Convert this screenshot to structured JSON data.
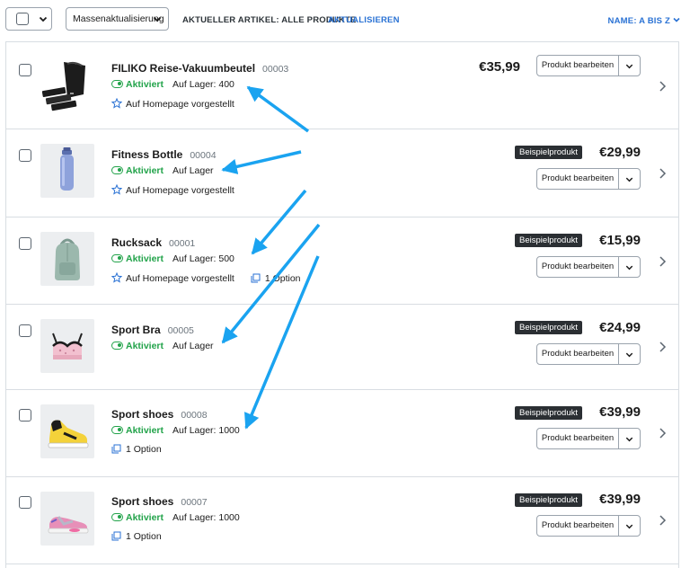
{
  "toolbar": {
    "bulk_label": "Massenaktualisierung",
    "current_article": "AKTUELLER ARTIKEL: ALLE PRODUKTE",
    "refresh_label": "AKTUALISIEREN",
    "sort_label": "NAME: A BIS Z"
  },
  "colors": {
    "accent": "#2a72d4",
    "active": "#22a34a",
    "badge": "#2b2f33",
    "annotation_arrow": "#1aa3f0"
  },
  "products": [
    {
      "name": "FILIKO Reise-Vakuumbeutel",
      "id": "00003",
      "status": "Aktiviert",
      "stock": "Auf Lager: 400",
      "featured": "Auf Homepage vorgestellt",
      "option": "",
      "badge": "",
      "price": "€35,99",
      "edit_label": "Produkt bearbeiten",
      "image": "vacuum-bags"
    },
    {
      "name": "Fitness Bottle",
      "id": "00004",
      "status": "Aktiviert",
      "stock": "Auf Lager",
      "featured": "Auf Homepage vorgestellt",
      "option": "",
      "badge": "Beispielprodukt",
      "price": "€29,99",
      "edit_label": "Produkt bearbeiten",
      "image": "bottle"
    },
    {
      "name": "Rucksack",
      "id": "00001",
      "status": "Aktiviert",
      "stock": "Auf Lager: 500",
      "featured": "Auf Homepage vorgestellt",
      "option": "1 Option",
      "badge": "Beispielprodukt",
      "price": "€15,99",
      "edit_label": "Produkt bearbeiten",
      "image": "backpack"
    },
    {
      "name": "Sport Bra",
      "id": "00005",
      "status": "Aktiviert",
      "stock": "Auf Lager",
      "featured": "",
      "option": "",
      "badge": "Beispielprodukt",
      "price": "€24,99",
      "edit_label": "Produkt bearbeiten",
      "image": "sport-bra"
    },
    {
      "name": "Sport shoes",
      "id": "00008",
      "status": "Aktiviert",
      "stock": "Auf Lager: 1000",
      "featured": "",
      "option": "1 Option",
      "badge": "Beispielprodukt",
      "price": "€39,99",
      "edit_label": "Produkt bearbeiten",
      "image": "shoe-yellow"
    },
    {
      "name": "Sport shoes",
      "id": "00007",
      "status": "Aktiviert",
      "stock": "Auf Lager: 1000",
      "featured": "",
      "option": "1 Option",
      "badge": "Beispielprodukt",
      "price": "€39,99",
      "edit_label": "Produkt bearbeiten",
      "image": "shoe-pink"
    }
  ]
}
